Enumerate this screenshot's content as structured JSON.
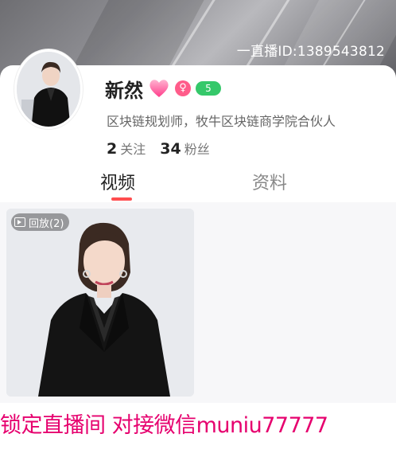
{
  "header": {
    "live_id": "一直播ID:1389543812"
  },
  "profile": {
    "name": "新然",
    "gender_symbol": "♀",
    "level": "5",
    "bio": "区块链规划师，牧牛区块链商学院合伙人",
    "following_count": "2",
    "following_label": "关注",
    "followers_count": "34",
    "followers_label": "粉丝"
  },
  "tabs": [
    {
      "label": "视频",
      "active": true
    },
    {
      "label": "资料",
      "active": false
    }
  ],
  "videos": [
    {
      "badge": "回放(2)"
    }
  ],
  "promo_text": "锁定直播间 对接微信muniu77777",
  "colors": {
    "accent": "#ff4d4f",
    "promo": "#e6006e",
    "level_badge": "#35c86a",
    "female": "#ff5c8a"
  }
}
